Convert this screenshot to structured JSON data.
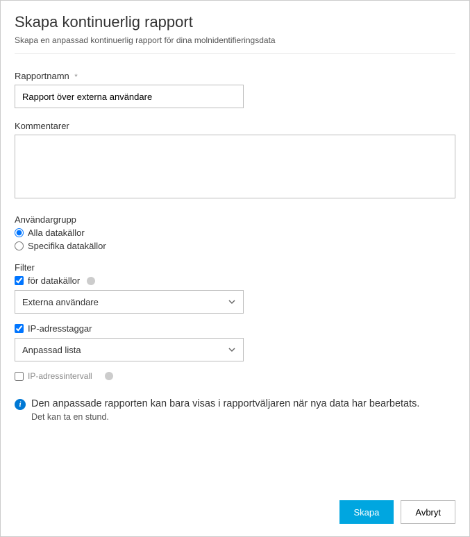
{
  "header": {
    "title": "Skapa kontinuerlig rapport",
    "subtitle": "Skapa en anpassad kontinuerlig rapport för dina molnidentifieringsdata"
  },
  "form": {
    "reportName": {
      "label": "Rapportnamn",
      "requiredMark": "*",
      "value": "Rapport över externa användare"
    },
    "comments": {
      "label": "Kommentarer",
      "value": ""
    },
    "userGroup": {
      "label": "Användargrupp",
      "options": {
        "all": "Alla datakällor",
        "specific": "Specifika datakällor"
      }
    },
    "filter": {
      "label": "Filter",
      "forDataSources": {
        "label": "för datakällor",
        "selected": "Externa användare"
      },
      "ipTags": {
        "label": "IP-adresstaggar",
        "selected": "Anpassad lista"
      },
      "ipRange": {
        "label": "IP-adressintervall"
      }
    }
  },
  "info": {
    "main": "Den anpassade rapporten kan bara visas i rapportväljaren när nya data har bearbetats.",
    "sub": "Det kan ta en stund."
  },
  "footer": {
    "create": "Skapa",
    "cancel": "Avbryt"
  }
}
